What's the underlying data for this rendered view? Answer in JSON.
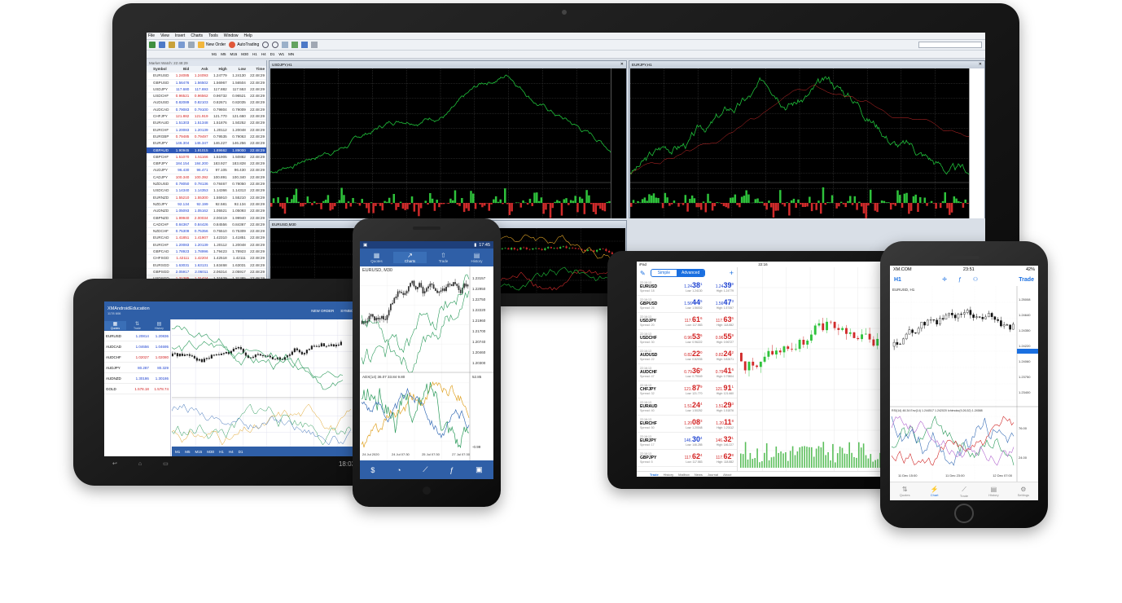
{
  "desktop": {
    "menu": [
      "File",
      "View",
      "Insert",
      "Charts",
      "Tools",
      "Window",
      "Help"
    ],
    "toolbar": {
      "new_order": "New Order",
      "autotrading": "AutoTrading"
    },
    "timeframes": [
      "M1",
      "M5",
      "M15",
      "M30",
      "H1",
      "H4",
      "D1",
      "W1",
      "MN"
    ],
    "market_watch": {
      "title": "Market Watch: 22:48:29",
      "headers": [
        "Symbol",
        "Bid",
        "Ask",
        "High",
        "Low",
        "Time"
      ],
      "rows": [
        [
          "EURUSD",
          "1.24085",
          "1.24093",
          "1.24779",
          "1.24130",
          "22:48:29"
        ],
        [
          "GBPUSD",
          "1.56476",
          "1.56502",
          "1.56967",
          "1.56504",
          "22:48:29"
        ],
        [
          "USDJPY",
          "117.680",
          "117.693",
          "117.882",
          "117.553",
          "22:48:29"
        ],
        [
          "USDCHF",
          "0.96521",
          "0.96562",
          "0.96732",
          "0.96521",
          "22:48:29"
        ],
        [
          "AUDUSD",
          "0.82089",
          "0.82103",
          "0.82671",
          "0.82035",
          "22:48:29"
        ],
        [
          "AUDCAD",
          "0.79083",
          "0.79100",
          "0.79804",
          "0.79009",
          "22:48:29"
        ],
        [
          "CHFJPY",
          "121.882",
          "121.919",
          "121.770",
          "121.660",
          "22:48:29"
        ],
        [
          "EURAUD",
          "1.51303",
          "1.51348",
          "1.51876",
          "1.50252",
          "22:48:29"
        ],
        [
          "EURCHF",
          "1.20083",
          "1.20139",
          "1.20112",
          "1.20048",
          "22:48:29"
        ],
        [
          "EURGBP",
          "0.79485",
          "0.79497",
          "0.79535",
          "0.79063",
          "22:48:29"
        ],
        [
          "EURJPY",
          "146.304",
          "146.347",
          "146.227",
          "146.256",
          "22:48:29"
        ],
        [
          "GBPAUD",
          "1.90945",
          "1.91015",
          "1.89662",
          "1.89000",
          "22:48:29"
        ],
        [
          "GBPCHF",
          "1.51070",
          "1.51166",
          "1.51905",
          "1.50882",
          "22:48:29"
        ],
        [
          "GBPJPY",
          "184.154",
          "184.200",
          "183.927",
          "183.828",
          "22:48:29"
        ],
        [
          "AUDJPY",
          "96.430",
          "96.471",
          "97.105",
          "96.430",
          "22:48:29"
        ],
        [
          "CADJPY",
          "100.340",
          "100.392",
          "100.891",
          "100.340",
          "22:48:29"
        ],
        [
          "NZDUSD",
          "0.78050",
          "0.78136",
          "0.78467",
          "0.78050",
          "22:48:29"
        ],
        [
          "USDCAD",
          "1.14340",
          "1.14353",
          "1.14366",
          "1.14313",
          "22:48:29"
        ],
        [
          "EURNZD",
          "1.55210",
          "1.55300",
          "1.55910",
          "1.55210",
          "22:48:29"
        ],
        [
          "NZDJPY",
          "92.134",
          "92.199",
          "92.581",
          "92.134",
          "22:48:29"
        ],
        [
          "AUDNZD",
          "1.05093",
          "1.05162",
          "1.05521",
          "1.05093",
          "22:48:29"
        ],
        [
          "GBPNZD",
          "1.99940",
          "2.00034",
          "2.00419",
          "1.99940",
          "22:48:29"
        ],
        [
          "CADCHF",
          "0.84367",
          "0.84426",
          "0.84556",
          "0.84367",
          "22:48:29"
        ],
        [
          "NZDCHF",
          "0.75309",
          "0.75356",
          "0.75510",
          "0.75309",
          "22:48:29"
        ],
        [
          "EURCAD",
          "1.41851",
          "1.41907",
          "1.42310",
          "1.41851",
          "22:48:29"
        ],
        [
          "EURCHF",
          "1.20083",
          "1.20139",
          "1.20112",
          "1.20048",
          "22:48:29"
        ],
        [
          "GBPCAD",
          "1.78923",
          "1.78996",
          "1.79423",
          "1.78923",
          "22:48:29"
        ],
        [
          "CHFSGD",
          "1.42111",
          "1.42204",
          "1.42518",
          "1.42111",
          "22:48:29"
        ],
        [
          "EURSGD",
          "1.63031",
          "1.63131",
          "1.63468",
          "1.63031",
          "22:48:29"
        ],
        [
          "GBPSGD",
          "2.05917",
          "2.06011",
          "2.06314",
          "2.05917",
          "22:48:29"
        ],
        [
          "USDSGD",
          "1.31385",
          "1.31424",
          "1.31629",
          "1.31385",
          "22:48:29"
        ]
      ]
    },
    "chart1_title": "USDJPY,H1",
    "chart2_title": "EURJPY,H1",
    "chart3_title": "EURUSD,M30",
    "ac_label": "AC 0.26057"
  },
  "left_tablet": {
    "app_title": "XMAndroidEducation",
    "sub": "1178 606",
    "top_buttons": [
      "NEW ORDER",
      "SYMBOLS"
    ],
    "tabs": [
      "Quotes",
      "Trade",
      "History"
    ],
    "quotes": [
      {
        "sym": "EURUSD",
        "bid": "1.20814",
        "ask": "1.20836",
        "bid_red": false
      },
      {
        "sym": "AUDCAD",
        "bid": "1.04656",
        "ask": "1.04695",
        "bid_red": false
      },
      {
        "sym": "AUDCHF",
        "bid": "1.02027",
        "ask": "1.02080",
        "bid_red": true
      },
      {
        "sym": "AUDJPY",
        "bid": "80.287",
        "ask": "80.329",
        "bid_red": false
      },
      {
        "sym": "AUDNZD",
        "bid": "1.30186",
        "ask": "1.30186",
        "bid_red": false
      },
      {
        "sym": "GOLD",
        "bid": "1.578.18",
        "ask": "1.578.74",
        "bid_red": true
      }
    ],
    "timeframes": [
      "M1",
      "M5",
      "M15",
      "M30",
      "H1",
      "H4",
      "D1"
    ],
    "status_time": "18:03"
  },
  "phone_center": {
    "time": "17:45",
    "tabs": [
      "Quotes",
      "Charts",
      "Trade",
      "History"
    ],
    "chart_title": "EURUSD, M30",
    "price_axis": [
      "1.23157",
      "1.22950",
      "1.22750",
      "1.22220",
      "1.21960",
      "1.21700",
      "1.20740",
      "1.20460",
      "1.20300"
    ],
    "indicator_label": "ADX(14) 36.07 33.84 9.80",
    "indicator_axis": [
      "52.85",
      "-0.99"
    ],
    "time_axis": [
      "24 Jul 2020",
      "24 Jul 07:30",
      "25 Jul 07:30",
      "27 Jul 07:30"
    ]
  },
  "ipad": {
    "status": "iPad",
    "time": "22:16",
    "mode_tabs": [
      "Simple",
      "Advanced"
    ],
    "quotes": [
      {
        "time": "22:16:13",
        "sym": "EURUSD",
        "spread": "Spread: 18",
        "bid": "1.24",
        "bid_big": "38",
        "bid_sup": "1",
        "ask": "1.24",
        "ask_big": "39",
        "ask_sup": "9",
        "low": "Low: 1.24130",
        "high": "High: 1.24779",
        "bid_color": "#1a3fd0",
        "ask_color": "#1a3fd0"
      },
      {
        "time": "22:16:13",
        "sym": "GBPUSD",
        "spread": "Spread: 26",
        "bid": "1.56",
        "bid_big": "44",
        "bid_sup": "5",
        "ask": "1.56",
        "ask_big": "47",
        "ask_sup": "3",
        "low": "Low: 1.56002",
        "high": "High: 1.57457",
        "bid_color": "#1a3fd0",
        "ask_color": "#1a3fd0"
      },
      {
        "time": "22:16:13",
        "sym": "USDJPY",
        "spread": "Spread: 20",
        "bid": "117.",
        "bid_big": "61",
        "bid_sup": "6",
        "ask": "117.",
        "ask_big": "63",
        "ask_sup": "6",
        "low": "Low: 117.583",
        "high": "High: 118.882",
        "bid_color": "#d21f1f",
        "ask_color": "#d21f1f"
      },
      {
        "time": "22:16:13",
        "sym": "USDCHF",
        "spread": "Spread: 30",
        "bid": "0.96",
        "bid_big": "53",
        "bid_sup": "6",
        "ask": "0.96",
        "ask_big": "55",
        "ask_sup": "9",
        "low": "Low: 0.96222",
        "high": "High: 0.96727",
        "bid_color": "#d21f1f",
        "ask_color": "#d21f1f"
      },
      {
        "time": "22:16:13",
        "sym": "AUDUSD",
        "spread": "Spread: 22",
        "bid": "0.82",
        "bid_big": "22",
        "bid_sup": "0",
        "ask": "0.82",
        "ask_big": "24",
        "ask_sup": "2",
        "low": "Low: 0.82035",
        "high": "High: 0.82671",
        "bid_color": "#d21f1f",
        "ask_color": "#d21f1f"
      },
      {
        "time": "22:16:13",
        "sym": "AUDCHF",
        "spread": "Spread: 47",
        "bid": "0.79",
        "bid_big": "36",
        "bid_sup": "9",
        "ask": "0.79",
        "ask_big": "41",
        "ask_sup": "6",
        "low": "Low: 0.79049",
        "high": "High: 0.79804",
        "bid_color": "#d21f1f",
        "ask_color": "#d21f1f"
      },
      {
        "time": "22:16:13",
        "sym": "CHFJPY",
        "spread": "Spread: 32",
        "bid": "121.",
        "bid_big": "87",
        "bid_sup": "9",
        "ask": "121.",
        "ask_big": "91",
        "ask_sup": "1",
        "low": "Low: 121.770",
        "high": "High: 121.660",
        "bid_color": "#d21f1f",
        "ask_color": "#d21f1f"
      },
      {
        "time": "22:16:13",
        "sym": "EURAUD",
        "spread": "Spread: 40",
        "bid": "1.51",
        "bid_big": "24",
        "bid_sup": "4",
        "ask": "1.51",
        "ask_big": "29",
        "ask_sup": "3",
        "low": "Low: 1.50252",
        "high": "High: 1.51876",
        "bid_color": "#d21f1f",
        "ask_color": "#d21f1f"
      },
      {
        "time": "22:16:13",
        "sym": "EURCHF",
        "spread": "Spread: 50",
        "bid": "1.20",
        "bid_big": "08",
        "bid_sup": "3",
        "ask": "1.20",
        "ask_big": "11",
        "ask_sup": "8",
        "low": "Low: 1.20048",
        "high": "High: 1.20112",
        "bid_color": "#d21f1f",
        "ask_color": "#d21f1f"
      },
      {
        "time": "22:16:13",
        "sym": "EURJPY",
        "spread": "Spread: 17",
        "bid": "146.",
        "bid_big": "30",
        "bid_sup": "4",
        "ask": "146.",
        "ask_big": "32",
        "ask_sup": "1",
        "low": "Low: 146.285",
        "high": "High: 146.227",
        "bid_color": "#1a3fd0",
        "ask_color": "#d21f1f"
      },
      {
        "time": "22:16:13",
        "sym": "GBPJPY",
        "spread": "Spread: 5",
        "bid": "117.",
        "bid_big": "62",
        "bid_sup": "4",
        "ask": "117.",
        "ask_big": "62",
        "ask_sup": "8",
        "low": "Low: 117.583",
        "high": "High: 118.882",
        "bid_color": "#d21f1f",
        "ask_color": "#d21f1f"
      }
    ],
    "bottom_tabs": [
      "Trade",
      "History",
      "Mailbox",
      "News",
      "Journal",
      "About"
    ]
  },
  "iphone": {
    "carrier": "XM.COM",
    "time": "23:51",
    "battery": "42%",
    "timeframe": "H1",
    "trade": "Trade",
    "chart_title": "EURUSD, H1",
    "price_axis": [
      "1.25008",
      "1.24640",
      "1.24350",
      "1.24220",
      "1.24060",
      "1.23750",
      "1.23400"
    ],
    "indicator_label": "RSI(14) 48.34 Env(14) 1.244517 1.242020 Ichimoku(9,26,52) 1.24588",
    "indicator_axis": [
      "76.00",
      "24.00"
    ],
    "time_axis": [
      "11 Dec 15:00",
      "11 Dec 23:00",
      "12 Dec 07:00"
    ],
    "tabs": [
      "Quotes",
      "Chart",
      "Trade",
      "History",
      "Settings"
    ]
  }
}
